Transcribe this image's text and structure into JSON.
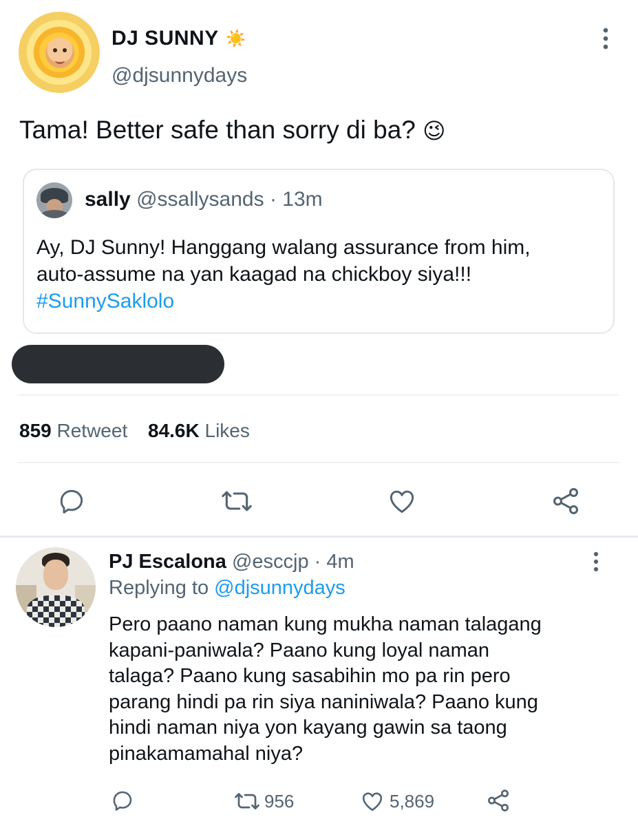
{
  "main_tweet": {
    "display_name": "DJ SUNNY",
    "name_emoji": "☀️",
    "handle": "@djsunnydays",
    "text": "Tama! Better safe than sorry di ba?",
    "text_emoji": "😉"
  },
  "quoted_tweet": {
    "display_name": "sally",
    "handle": "@ssallysands",
    "separator": "·",
    "time": "13m",
    "text_line1": "Ay, DJ Sunny! Hanggang walang assurance from him,",
    "text_line2": "auto-assume na yan kaagad na chickboy siya!!!",
    "hashtag": "#SunnySaklolo"
  },
  "stats": {
    "retweets_count": "859",
    "retweets_label": "Retweet",
    "likes_count": "84.6K",
    "likes_label": "Likes"
  },
  "reply": {
    "display_name": "PJ Escalona",
    "handle": "@esccjp",
    "separator": "·",
    "time": "4m",
    "replying_prefix": "Replying to",
    "replying_to": "@djsunnydays",
    "lines": [
      "Pero paano naman kung mukha naman talagang",
      "kapani-paniwala? Paano kung loyal naman",
      "talaga? Paano kung sasabihin mo pa rin pero",
      "parang hindi pa rin siya naniniwala? Paano kung",
      "hindi naman niya yon kayang gawin sa taong",
      "pinakamamahal niya?"
    ],
    "retweet_count": "956",
    "like_count": "5,869"
  },
  "icons": [
    "more-icon",
    "reply-icon",
    "retweet-icon",
    "like-icon",
    "share-icon"
  ],
  "colors": {
    "link": "#1d9bf0",
    "muted": "#536471",
    "text": "#0f1419",
    "redaction": "#2b2f33"
  }
}
